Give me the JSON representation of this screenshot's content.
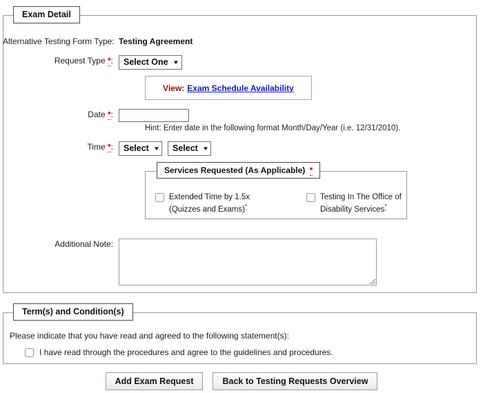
{
  "exam_detail": {
    "legend": "Exam Detail",
    "form_type": {
      "label": "Alternative Testing Form Type:",
      "value": "Testing Agreement"
    },
    "request_type": {
      "label": "Request Type",
      "required_marker": "*",
      "colon": ":",
      "selected": "Select One",
      "caret": "▼",
      "options": [
        "Select One"
      ]
    },
    "view_schedule": {
      "prefix": "View:",
      "link_text": "Exam Schedule Availability"
    },
    "date": {
      "label": "Date",
      "required_marker": "*",
      "colon": ":",
      "value": "",
      "placeholder": "",
      "hint": "Hint: Enter date in the following format Month/Day/Year (i.e. 12/31/2010)."
    },
    "time": {
      "label": "Time",
      "required_marker": "*",
      "colon": ":",
      "start_selected": "Select",
      "end_selected": "Select",
      "caret": "▼",
      "options": [
        "Select"
      ]
    },
    "services": {
      "legend": "Services Requested (As Applicable)",
      "required_marker": "*",
      "items": [
        {
          "label": "Extended Time by 1.5x (Quizzes and Exams)",
          "marker": "*",
          "checked": false
        },
        {
          "label": "Testing In The Office of Disability Services",
          "marker": "*",
          "checked": false
        }
      ]
    },
    "additional_note": {
      "label": "Additional Note:",
      "value": "",
      "placeholder": ""
    }
  },
  "terms": {
    "legend": "Term(s) and Condition(s)",
    "intro": "Please indicate that you have read and agreed to the following statement(s):",
    "agree_label": "I have read through the procedures and agree to the guidelines and procedures.",
    "agree_checked": false
  },
  "buttons": {
    "submit_label": "Add Exam Request",
    "back_label": "Back to Testing Requests Overview"
  },
  "colors": {
    "required_red": "#b01111",
    "link_blue": "#1414c8",
    "view_maroon": "#8d1111",
    "border_gray": "#9a9a9a"
  }
}
